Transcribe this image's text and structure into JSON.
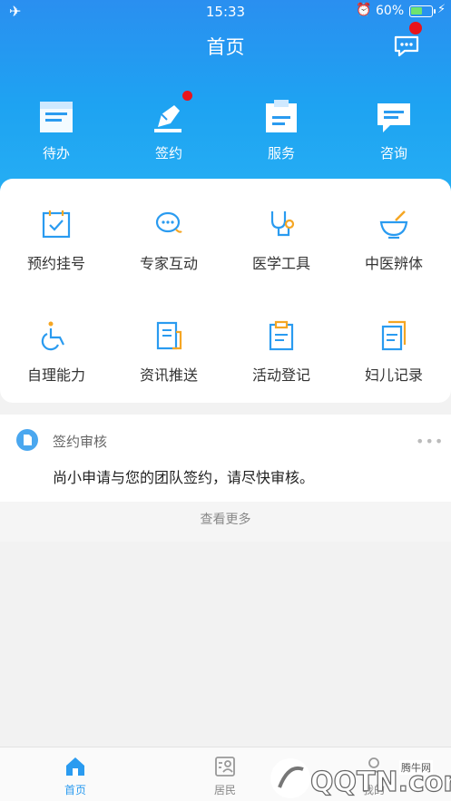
{
  "status_bar": {
    "time": "15:33",
    "battery_percent": "60%",
    "battery_level": 0.6
  },
  "header": {
    "title": "首页"
  },
  "top_nav": [
    {
      "label": "待办",
      "icon": "todo-icon"
    },
    {
      "label": "签约",
      "icon": "sign-pen-icon",
      "has_badge": true
    },
    {
      "label": "服务",
      "icon": "service-icon"
    },
    {
      "label": "咨询",
      "icon": "consult-icon"
    }
  ],
  "grid": [
    {
      "label": "预约挂号",
      "icon": "calendar-check-icon"
    },
    {
      "label": "专家互动",
      "icon": "chat-bubble-icon"
    },
    {
      "label": "医学工具",
      "icon": "stethoscope-icon"
    },
    {
      "label": "中医辨体",
      "icon": "mortar-bowl-icon"
    },
    {
      "label": "自理能力",
      "icon": "wheelchair-icon"
    },
    {
      "label": "资讯推送",
      "icon": "news-icon"
    },
    {
      "label": "活动登记",
      "icon": "clipboard-icon"
    },
    {
      "label": "妇儿记录",
      "icon": "record-doc-icon"
    }
  ],
  "notice": {
    "title": "签约审核",
    "more": "•••",
    "content": "尚小申请与您的团队签约，请尽快审核。",
    "view_more": "查看更多"
  },
  "tabbar": [
    {
      "label": "首页",
      "icon": "home-icon",
      "active": true
    },
    {
      "label": "居民",
      "icon": "resident-icon",
      "active": false
    },
    {
      "label": "我的",
      "icon": "profile-icon",
      "active": false
    }
  ],
  "watermark": {
    "text": "QQTN.com",
    "site": "腾牛网"
  },
  "colors": {
    "header_top": "#2a8ff0",
    "header_bottom": "#29b3f4",
    "accent": "#2a9bf0",
    "badge_red": "#e8141b",
    "icon_orange": "#f5a623"
  }
}
